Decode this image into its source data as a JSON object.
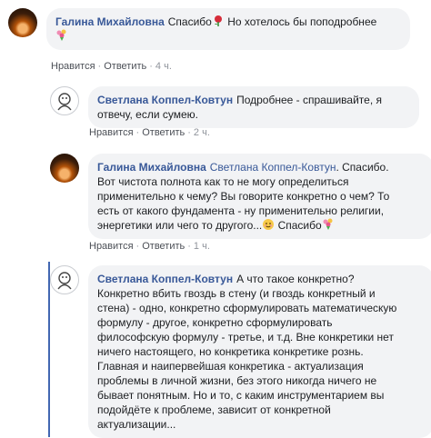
{
  "comments": [
    {
      "author": "Галина Михайловна",
      "mention": "",
      "text_parts": [
        "Спасибо",
        " Но хотелось бы поподробнее"
      ],
      "actions": {
        "like": "Нравится",
        "reply": "Ответить",
        "time": "4 ч."
      },
      "icons": [
        "rose-emoji",
        "bouquet-emoji"
      ]
    },
    {
      "author": "Светлана Коппел-Ковтун",
      "mention": "",
      "text_lines": [
        "Подробнее - спрашивайте, я",
        "отвечу, если сумею."
      ],
      "actions": {
        "like": "Нравится",
        "reply": "Ответить",
        "time": "2 ч."
      }
    },
    {
      "author": "Галина Михайловна",
      "mention": "Светлана Коппел-Ковтун",
      "text_first": ". Спасибо.",
      "text_lines": [
        "Вот чистота полнота как то не могу определиться",
        "применительно к чему? Вы говорите конкретно о чем? То",
        "есть от какого фундамента - ну применительно религии,",
        "энергетики или чего то другого..."
      ],
      "text_end": " Спасибо",
      "actions": {
        "like": "Нравится",
        "reply": "Ответить",
        "time": "1 ч."
      },
      "icons": [
        "smile-emoji",
        "bouquet-emoji"
      ]
    },
    {
      "author": "Светлана Коппел-Ковтун",
      "text_first": "А что такое конкретно?",
      "text_lines": [
        "Конкретно вбить гвоздь в стену (и гвоздь конкретный и",
        "стена) - одно, конкретно сформулировать математическую",
        "формулу - другое, конкретно сформулировать",
        "философскую формулу - третье, и т.д. Вне конкретики нет",
        "ничего настоящего, но конкретика конкретике рознь.",
        "Главная и наипервейшая конкретика - актуализация",
        "проблемы в личной жизни, без этого никогда ничего не",
        "бывает понятным. Но и то, с каким инструментарием вы",
        "подойдёте к проблеме, зависит от конкретной",
        "актуализации..."
      ]
    }
  ],
  "colors": {
    "name": "#385898",
    "bubble": "#f2f3f5",
    "meta": "#90949c",
    "thread": "#4267b2"
  }
}
